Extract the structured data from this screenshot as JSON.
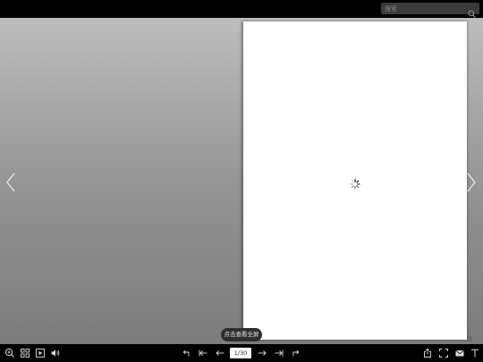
{
  "search": {
    "placeholder": "搜索",
    "icon": "search-icon"
  },
  "viewer": {
    "tooltip": "点击查看全屏",
    "page_indicator": "1/30",
    "loading_icon": "spinner-icon"
  },
  "toolbar_left": [
    "zoom-icon",
    "thumbnails-icon",
    "autoplay-icon",
    "sound-icon"
  ],
  "toolbar_center": [
    "undo-icon",
    "first-page-icon",
    "prev-page-icon",
    "next-page-icon",
    "last-page-icon",
    "redo-icon"
  ],
  "toolbar_right": [
    "share-icon",
    "fullscreen-icon",
    "email-icon",
    "text-icon"
  ],
  "colors": {
    "bar": "#000000",
    "stage_top": "#bdbdbd",
    "stage_bottom": "#7c7c7c",
    "page": "#ffffff"
  }
}
